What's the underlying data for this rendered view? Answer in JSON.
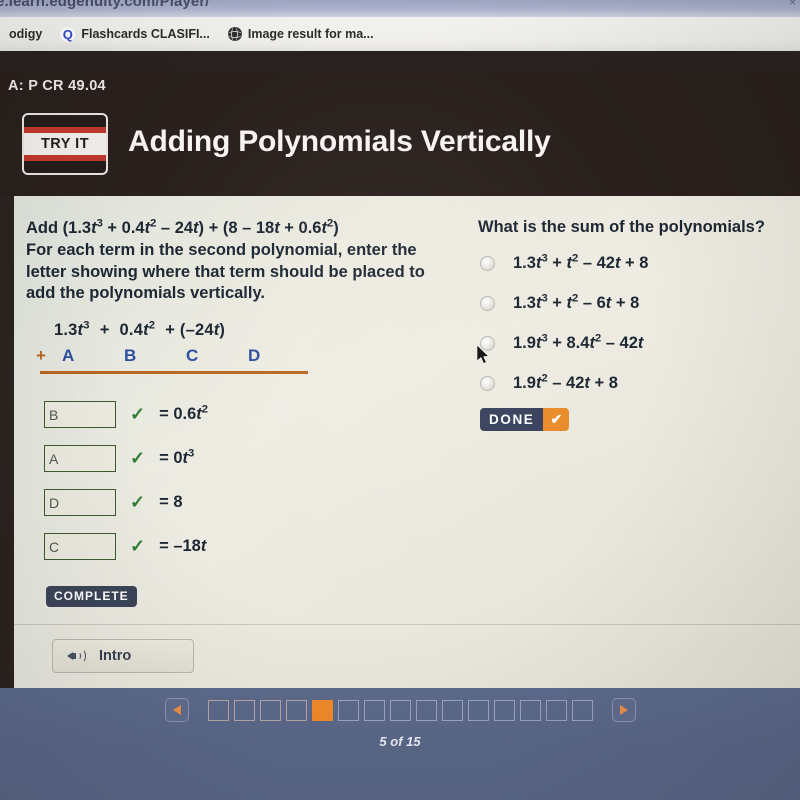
{
  "browser": {
    "url": "e.learn.edgenuity.com/Player/",
    "url_right_glyph": "×",
    "bookmarks": [
      {
        "label": "odigy",
        "icon": "none"
      },
      {
        "label": "Flashcards CLASIFI...",
        "icon": "quizlet-q-icon",
        "icon_glyph": "Q"
      },
      {
        "label": "Image result for ma...",
        "icon": "globe-icon"
      }
    ]
  },
  "header": {
    "course_code": "A: P CR 49.04",
    "badge_label": "TRY IT",
    "lesson_title": "Adding Polynomials Vertically"
  },
  "left": {
    "prompt_line1_a": "Add (1.3",
    "prompt_expr": "Add (1.3t³ + 0.4t² – 24t) + (8 – 18t + 0.6t²)",
    "prompt_line2": "For each term in the second polynomial, enter the",
    "prompt_line3": "letter showing where that term should be placed to",
    "prompt_line4": "add the polynomials vertically.",
    "vertical_expression": "1.3t³  +  0.4t²  + (–24t)",
    "plus_sign": "+",
    "letters": [
      "A",
      "B",
      "C",
      "D"
    ],
    "answers": [
      {
        "input_value": "B",
        "check": "✓",
        "result": "= 0.6t²"
      },
      {
        "input_value": "A",
        "check": "✓",
        "result": "= 0t³"
      },
      {
        "input_value": "D",
        "check": "✓",
        "result": "= 8"
      },
      {
        "input_value": "C",
        "check": "✓",
        "result": "= –18t"
      }
    ],
    "complete_label": "COMPLETE",
    "intro_label": "Intro"
  },
  "right": {
    "question": "What is the sum of the polynomials?",
    "options": [
      {
        "text": "1.3t³ + t² – 42t + 8",
        "selected": false
      },
      {
        "text": "1.3t³ + t² – 6t + 8",
        "selected": false
      },
      {
        "text": "1.9t³ + 8.4t² – 42t",
        "selected": false
      },
      {
        "text": "1.9t² – 42t + 8",
        "selected": false
      }
    ],
    "done_label": "DONE",
    "done_check": "✔"
  },
  "footer": {
    "page_count": "5 of 15",
    "total_pages": 15,
    "current_page": 5,
    "prev_label": "◀",
    "next_label": "▶"
  },
  "colors": {
    "accent_orange": "#ef8a2a",
    "navy": "#39415c",
    "footer_blue": "#5b6889",
    "header_dark": "#2a211e",
    "rule_orange": "#b9661f",
    "letter_blue": "#2d4fa0",
    "check_green": "#2e7d32"
  }
}
